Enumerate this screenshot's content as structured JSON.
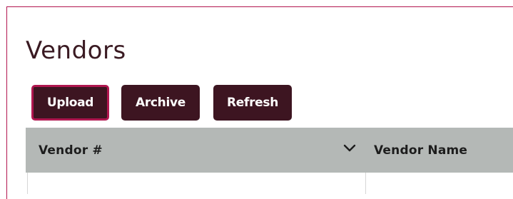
{
  "page": {
    "title": "Vendors"
  },
  "toolbar": {
    "upload_label": "Upload",
    "archive_label": "Archive",
    "refresh_label": "Refresh"
  },
  "grid": {
    "columns": [
      {
        "label": "Vendor #",
        "has_sort_icon": true,
        "sort_icon": "chevron-down-icon"
      },
      {
        "label": "Vendor Name"
      }
    ]
  },
  "colors": {
    "brand": "#3d1521",
    "accent": "#b0174f",
    "header_bg": "#b4b8b6"
  }
}
